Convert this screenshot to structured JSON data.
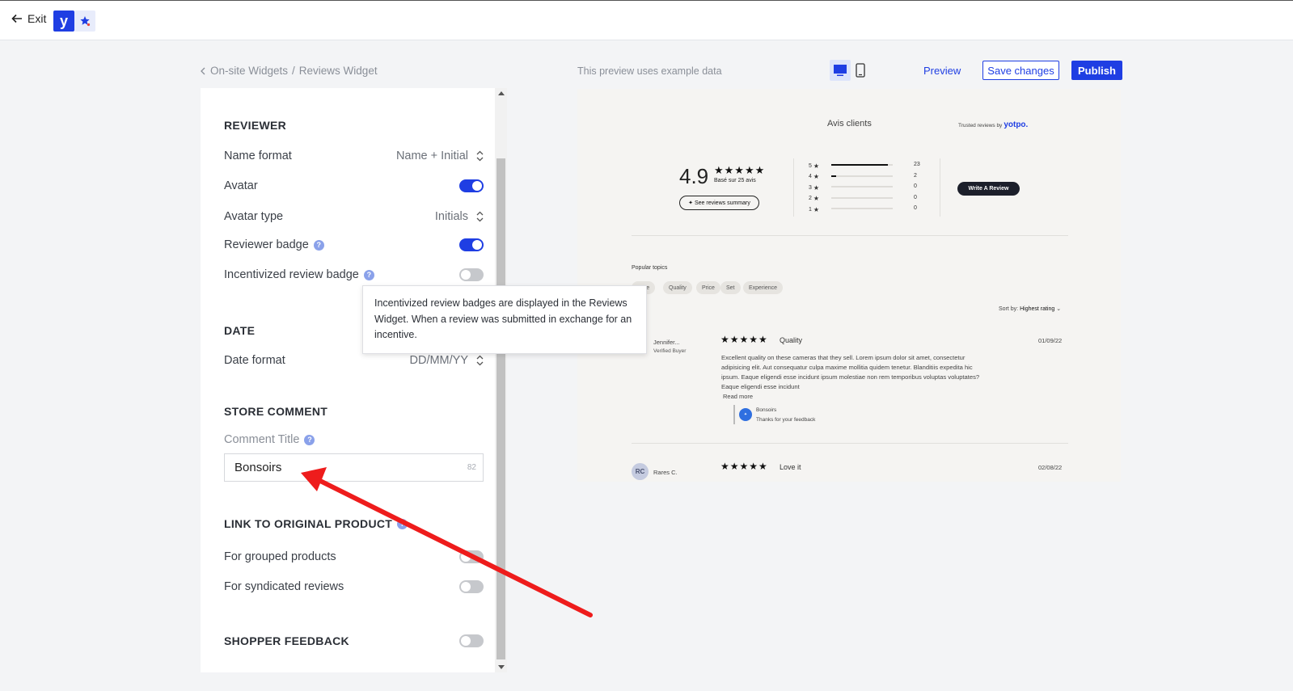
{
  "topbar": {
    "exit_label": "Exit",
    "logo_letter": "y"
  },
  "breadcrumb": {
    "parent": "On-site Widgets",
    "separator": "/",
    "current": "Reviews Widget"
  },
  "preview_note": "This preview uses example data",
  "actions": {
    "preview": "Preview",
    "save": "Save changes",
    "publish": "Publish"
  },
  "reviewer": {
    "title": "REVIEWER",
    "name_format_label": "Name format",
    "name_format_value": "Name + Initial",
    "avatar_label": "Avatar",
    "avatar_on": true,
    "avatar_type_label": "Avatar type",
    "avatar_type_value": "Initials",
    "badge_label": "Reviewer badge",
    "badge_on": true,
    "incentivized_label": "Incentivized review badge",
    "incentivized_on": false
  },
  "date": {
    "title": "DATE",
    "format_label": "Date format",
    "format_value": "DD/MM/YY"
  },
  "store_comment": {
    "title": "STORE COMMENT",
    "comment_title_label": "Comment Title",
    "comment_value": "Bonsoirs",
    "char_count": "82"
  },
  "link_original": {
    "title": "LINK TO ORIGINAL PRODUCT",
    "grouped_label": "For grouped products",
    "grouped_on": false,
    "syndicated_label": "For syndicated reviews",
    "syndicated_on": false
  },
  "shopper_feedback": {
    "title": "SHOPPER FEEDBACK",
    "on": false
  },
  "tooltip": "Incentivized review badges are displayed in the Reviews Widget. When a review was submitted in exchange for an incentive.",
  "widget": {
    "title": "Avis clients",
    "trusted_prefix": "Trusted reviews by",
    "trusted_brand": "yotpo.",
    "score": "4.9",
    "stars": "★★★★★",
    "based_on": "Basé sur 25 avis",
    "summary_button": "See reviews summary",
    "distribution": [
      {
        "stars": "5",
        "count": "23",
        "fraction": 0.92
      },
      {
        "stars": "4",
        "count": "2",
        "fraction": 0.08
      },
      {
        "stars": "3",
        "count": "0",
        "fraction": 0
      },
      {
        "stars": "2",
        "count": "0",
        "fraction": 0
      },
      {
        "stars": "1",
        "count": "0",
        "fraction": 0
      }
    ],
    "write_button": "Write A Review",
    "popular_topics_label": "Popular topics",
    "topics": [
      "ance",
      "Quality",
      "Price",
      "Set",
      "Experience"
    ],
    "sort_label": "Sort by:",
    "sort_value": "Highest rating",
    "review1": {
      "reviewer": "Jennifer...",
      "verified": "Verified Buyer",
      "stars": "★★★★★",
      "title": "Quality",
      "date": "01/09/22",
      "body": "Excellent quality on these cameras that they sell. Lorem ipsum dolor sit amet, consectetur adipisicing elit. Aut consequatur culpa maxime mollitia quidem tenetur. Blanditiis expedita hic ipsum. Eaque eligendi esse incidunt ipsum molestiae non rem temporibus voluptas voluptates?  Eaque eligendi esse incidunt",
      "read_more": "Read more",
      "reply_name": "Bonsoirs",
      "reply_text": "Thanks for your feedback"
    },
    "review2": {
      "initials": "RC",
      "reviewer": "Rares C.",
      "stars": "★★★★★",
      "title": "Love it",
      "date": "02/08/22"
    }
  },
  "colors": {
    "accent": "#1f3ee3",
    "annotation_arrow": "#ee1c1c"
  }
}
